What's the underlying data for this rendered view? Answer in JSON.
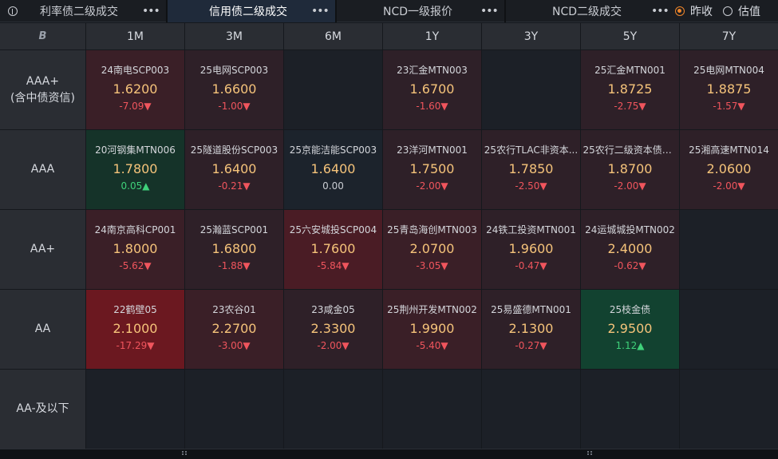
{
  "tabs": [
    {
      "label": "利率债二级成交",
      "more": "•••",
      "active": false
    },
    {
      "label": "信用债二级成交",
      "more": "•••",
      "active": true
    },
    {
      "label": "NCD一级报价",
      "more": "•••",
      "active": false
    },
    {
      "label": "NCD二级成交",
      "more": "•••",
      "active": false
    }
  ],
  "radios": [
    {
      "label": "昨收",
      "checked": true
    },
    {
      "label": "估值",
      "checked": false
    }
  ],
  "corner_logo": "B",
  "columns": [
    "1M",
    "3M",
    "6M",
    "1Y",
    "3Y",
    "5Y",
    "7Y"
  ],
  "rows": [
    {
      "label": "AAA+\n(含中债资信)",
      "cells": [
        {
          "name": "24南电SCP003",
          "yield": "1.6200",
          "change": "-7.09▼",
          "dir": "down",
          "bg": "bg-r2"
        },
        {
          "name": "25电网SCP003",
          "yield": "1.6600",
          "change": "-1.00▼",
          "dir": "down",
          "bg": "bg-r1"
        },
        null,
        {
          "name": "23汇金MTN003",
          "yield": "1.6700",
          "change": "-1.60▼",
          "dir": "down",
          "bg": "bg-r1"
        },
        null,
        {
          "name": "25汇金MTN001",
          "yield": "1.8725",
          "change": "-2.75▼",
          "dir": "down",
          "bg": "bg-r1"
        },
        {
          "name": "25电网MTN004",
          "yield": "1.8875",
          "change": "-1.57▼",
          "dir": "down",
          "bg": "bg-r1"
        }
      ]
    },
    {
      "label": "AAA",
      "cells": [
        {
          "name": "20河钢集MTN006",
          "yield": "1.7800",
          "change": "0.05▲",
          "dir": "up",
          "bg": "bg-g1"
        },
        {
          "name": "25隧道股份SCP003",
          "yield": "1.6400",
          "change": "-0.21▼",
          "dir": "down",
          "bg": "bg-r1"
        },
        {
          "name": "25京能洁能SCP003",
          "yield": "1.6400",
          "change": "0.00",
          "dir": "flat",
          "bg": "bg-neutral"
        },
        {
          "name": "23洋河MTN001",
          "yield": "1.7500",
          "change": "-2.00▼",
          "dir": "down",
          "bg": "bg-r1"
        },
        {
          "name": "25农行TLAC非资本...",
          "yield": "1.7850",
          "change": "-2.50▼",
          "dir": "down",
          "bg": "bg-r1"
        },
        {
          "name": "25农行二级资本债0...",
          "yield": "1.8700",
          "change": "-2.00▼",
          "dir": "down",
          "bg": "bg-r1"
        },
        {
          "name": "25湘高速MTN014",
          "yield": "2.0600",
          "change": "-2.00▼",
          "dir": "down",
          "bg": "bg-r1"
        }
      ]
    },
    {
      "label": "AA+",
      "cells": [
        {
          "name": "24南京高科CP001",
          "yield": "1.8000",
          "change": "-5.62▼",
          "dir": "down",
          "bg": "bg-r2"
        },
        {
          "name": "25瀚蓝SCP001",
          "yield": "1.6800",
          "change": "-1.88▼",
          "dir": "down",
          "bg": "bg-r1"
        },
        {
          "name": "25六安城投SCP004",
          "yield": "1.7600",
          "change": "-5.84▼",
          "dir": "down",
          "bg": "bg-r3"
        },
        {
          "name": "25青岛海创MTN003",
          "yield": "2.0700",
          "change": "-3.05▼",
          "dir": "down",
          "bg": "bg-r2"
        },
        {
          "name": "24铁工投资MTN001",
          "yield": "1.9600",
          "change": "-0.47▼",
          "dir": "down",
          "bg": "bg-r1"
        },
        {
          "name": "24运城城投MTN002",
          "yield": "2.4000",
          "change": "-0.62▼",
          "dir": "down",
          "bg": "bg-r1"
        },
        null
      ]
    },
    {
      "label": "AA",
      "cells": [
        {
          "name": "22鹤壁05",
          "yield": "2.1000",
          "change": "-17.29▼",
          "dir": "down",
          "bg": "bg-r4"
        },
        {
          "name": "23农谷01",
          "yield": "2.2700",
          "change": "-3.00▼",
          "dir": "down",
          "bg": "bg-r2"
        },
        {
          "name": "23咸金05",
          "yield": "2.3300",
          "change": "-2.00▼",
          "dir": "down",
          "bg": "bg-r1"
        },
        {
          "name": "25荆州开发MTN002",
          "yield": "1.9900",
          "change": "-5.40▼",
          "dir": "down",
          "bg": "bg-r2"
        },
        {
          "name": "25易盛德MTN001",
          "yield": "2.1300",
          "change": "-0.27▼",
          "dir": "down",
          "bg": "bg-r1"
        },
        {
          "name": "25枝金债",
          "yield": "2.9500",
          "change": "1.12▲",
          "dir": "up",
          "bg": "bg-g2"
        },
        null
      ]
    },
    {
      "label": "AA-及以下",
      "cells": [
        null,
        null,
        null,
        null,
        null,
        null,
        null
      ]
    }
  ]
}
